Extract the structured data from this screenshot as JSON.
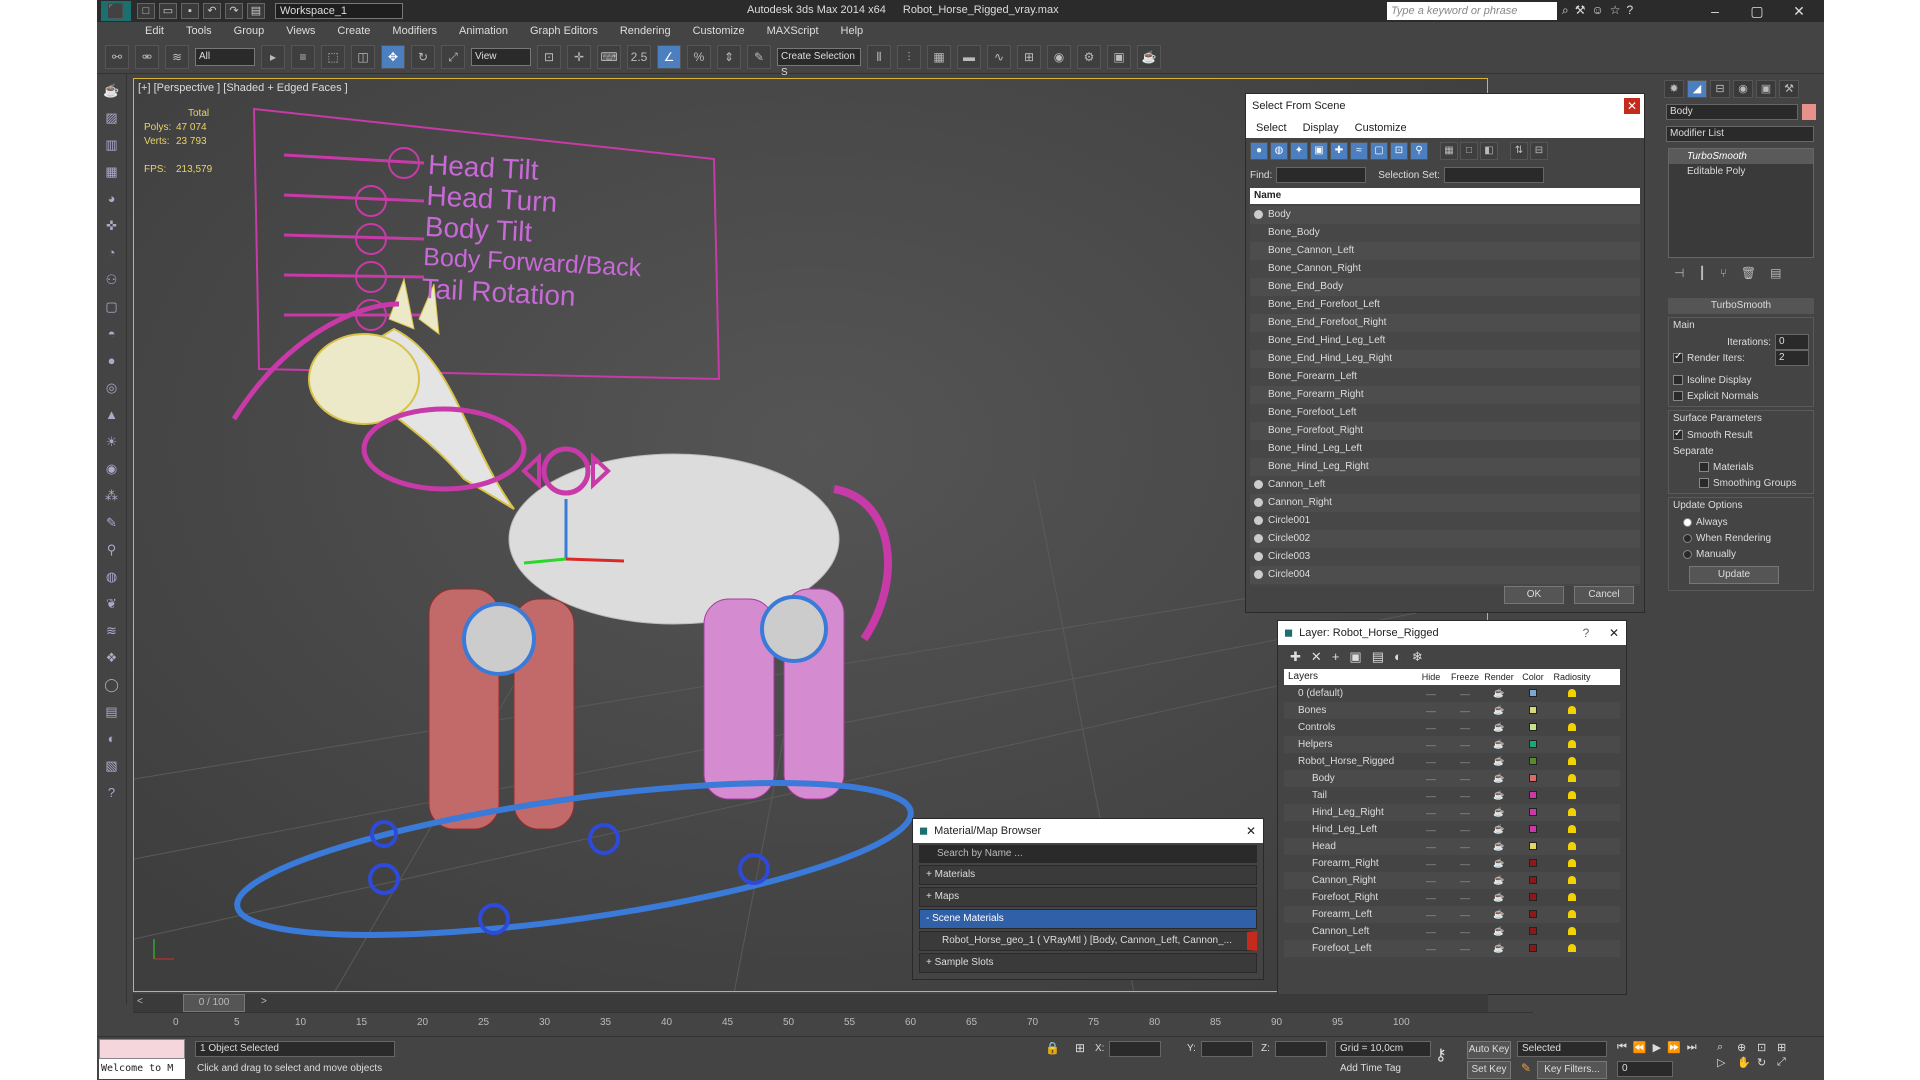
{
  "titlebar": {
    "workspace": "Workspace_1",
    "app_title": "Autodesk 3ds Max  2014 x64",
    "file_title": "Robot_Horse_Rigged_vray.max",
    "search_placeholder": "Type a keyword or phrase"
  },
  "menu": [
    "Edit",
    "Tools",
    "Group",
    "Views",
    "Create",
    "Modifiers",
    "Animation",
    "Graph Editors",
    "Rendering",
    "Customize",
    "MAXScript",
    "Help"
  ],
  "toolbar": {
    "filter": "All",
    "refcoord": "View",
    "snap_label": "2.5",
    "selection_set": "Create Selection S"
  },
  "viewport": {
    "label": "[+] [Perspective ] [Shaded + Edged Faces ]",
    "stats": {
      "total": "Total",
      "polys_label": "Polys:",
      "polys": "47 074",
      "verts_label": "Verts:",
      "verts": "23 793",
      "fps_label": "FPS:",
      "fps": "213,579"
    },
    "controls": [
      "Head Tilt",
      "Head Turn",
      "Body Tilt",
      "Body Forward/Back",
      "Tail Rotation"
    ]
  },
  "select_from_scene": {
    "title": "Select From Scene",
    "menus": [
      "Select",
      "Display",
      "Customize"
    ],
    "find_label": "Find:",
    "selset_label": "Selection Set:",
    "column_name": "Name",
    "items": [
      "Body",
      "Bone_Body",
      "Bone_Cannon_Left",
      "Bone_Cannon_Right",
      "Bone_End_Body",
      "Bone_End_Forefoot_Left",
      "Bone_End_Forefoot_Right",
      "Bone_End_Hind_Leg_Left",
      "Bone_End_Hind_Leg_Right",
      "Bone_Forearm_Left",
      "Bone_Forearm_Right",
      "Bone_Forefoot_Left",
      "Bone_Forefoot_Right",
      "Bone_Hind_Leg_Left",
      "Bone_Hind_Leg_Right",
      "Cannon_Left",
      "Cannon_Right",
      "Circle001",
      "Circle002",
      "Circle003",
      "Circle004"
    ],
    "ok": "OK",
    "cancel": "Cancel"
  },
  "layer_panel": {
    "title": "Layer: Robot_Horse_Rigged",
    "columns": [
      "Layers",
      "Hide",
      "Freeze",
      "Render",
      "Color",
      "Radiosity"
    ],
    "layers": [
      {
        "name": "0 (default)",
        "color": "#7aa7d8"
      },
      {
        "name": "Bones",
        "color": "#d8d87a"
      },
      {
        "name": "Controls",
        "color": "#c8e08a"
      },
      {
        "name": "Helpers",
        "color": "#1aa67a"
      },
      {
        "name": "Robot_Horse_Rigged",
        "color": "#5a8a2a"
      },
      {
        "name": "Body",
        "color": "#d86a6a"
      },
      {
        "name": "Tail",
        "color": "#c83aa8"
      },
      {
        "name": "Hind_Leg_Right",
        "color": "#c83aa8"
      },
      {
        "name": "Hind_Leg_Left",
        "color": "#c83aa8"
      },
      {
        "name": "Head",
        "color": "#e0d860"
      },
      {
        "name": "Forearm_Right",
        "color": "#8a1a1a"
      },
      {
        "name": "Cannon_Right",
        "color": "#8a1a1a"
      },
      {
        "name": "Forefoot_Right",
        "color": "#8a1a1a"
      },
      {
        "name": "Forearm_Left",
        "color": "#8a1a1a"
      },
      {
        "name": "Cannon_Left",
        "color": "#8a1a1a"
      },
      {
        "name": "Forefoot_Left",
        "color": "#8a1a1a"
      }
    ]
  },
  "material_browser": {
    "title": "Material/Map Browser",
    "search_placeholder": "Search by Name ...",
    "groups": [
      "+ Materials",
      "+ Maps",
      "- Scene Materials"
    ],
    "scene_material": "Robot_Horse_geo_1  ( VRayMtl ) [Body, Cannon_Left, Cannon_...",
    "sample_slots": "+ Sample Slots"
  },
  "command_panel": {
    "object_name": "Body",
    "modifier_list": "Modifier List",
    "stack": [
      "TurboSmooth",
      "Editable Poly"
    ],
    "rollout": "TurboSmooth",
    "main": "Main",
    "iterations_label": "Iterations:",
    "iterations": "0",
    "render_iters_label": "Render Iters:",
    "render_iters": "2",
    "isoline": "Isoline Display",
    "explicit_normals": "Explicit Normals",
    "surface_params": "Surface Parameters",
    "smooth_result": "Smooth Result",
    "separate": "Separate",
    "materials": "Materials",
    "smoothing_groups": "Smoothing Groups",
    "update_options": "Update Options",
    "always": "Always",
    "when_rendering": "When Rendering",
    "manually": "Manually",
    "update": "Update"
  },
  "timeline": {
    "frame": "0 / 100",
    "ticks": [
      "0",
      "5",
      "10",
      "15",
      "20",
      "25",
      "30",
      "35",
      "40",
      "45",
      "50",
      "55",
      "60",
      "65",
      "70",
      "75",
      "80",
      "85",
      "90",
      "95",
      "100"
    ]
  },
  "status": {
    "maxscript": "Welcome to M",
    "selected": "1 Object Selected",
    "prompt": "Click and drag to select and move objects",
    "x_label": "X:",
    "y_label": "Y:",
    "z_label": "Z:",
    "grid": "Grid = 10,0cm",
    "add_time_tag": "Add Time Tag",
    "auto_key": "Auto Key",
    "set_key": "Set Key",
    "key_mode": "Selected",
    "key_filters": "Key Filters...",
    "frame_field": "0"
  },
  "colors": {
    "viewport_border": "#d7b431",
    "control_panel_lines": "#c83aa8",
    "selection_blue": "#3060a8"
  }
}
